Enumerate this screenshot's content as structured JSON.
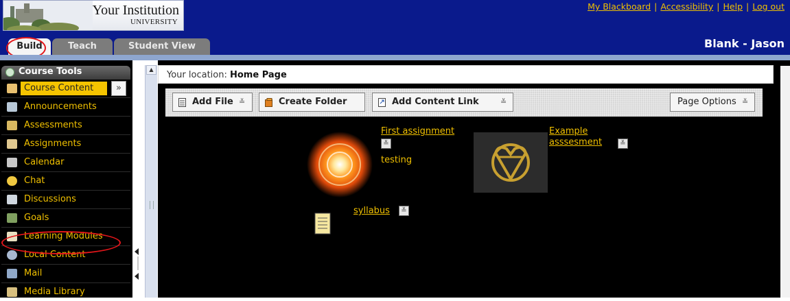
{
  "header": {
    "logo": {
      "name": "Your Institution",
      "subtitle": "UNIVERSITY"
    },
    "top_links": [
      "My Blackboard",
      "Accessibility",
      "Help",
      "Log out"
    ],
    "user_name": "Blank - Jason",
    "tabs": [
      {
        "label": "Build",
        "active": true
      },
      {
        "label": "Teach",
        "active": false
      },
      {
        "label": "Student View",
        "active": false
      }
    ]
  },
  "sidebar": {
    "title": "Course Tools",
    "items": [
      {
        "label": "Course Content",
        "icon": "home-icon",
        "selected": true
      },
      {
        "label": "Announcements",
        "icon": "megaphone-icon"
      },
      {
        "label": "Assessments",
        "icon": "assessment-icon"
      },
      {
        "label": "Assignments",
        "icon": "assignment-icon"
      },
      {
        "label": "Calendar",
        "icon": "calendar-icon"
      },
      {
        "label": "Chat",
        "icon": "chat-icon"
      },
      {
        "label": "Discussions",
        "icon": "discussion-icon"
      },
      {
        "label": "Goals",
        "icon": "goals-icon"
      },
      {
        "label": "Learning Modules",
        "icon": "module-icon"
      },
      {
        "label": "Local Content",
        "icon": "disc-icon"
      },
      {
        "label": "Mail",
        "icon": "mail-icon"
      },
      {
        "label": "Media Library",
        "icon": "media-icon"
      }
    ],
    "chevron": "»"
  },
  "main": {
    "location_label": "Your location:",
    "location_value": "Home Page",
    "actions": {
      "add_file": "Add File",
      "create_folder": "Create Folder",
      "add_content_link": "Add Content Link",
      "page_options": "Page Options",
      "dropdown_glyph": "≚"
    },
    "items": {
      "first_assignment": "First assignment",
      "testing": "testing",
      "example_assessment": "Example asssesment",
      "syllabus": "syllabus"
    }
  },
  "colors": {
    "header_bg": "#0a1a8c",
    "link_yellow": "#f0c000",
    "highlight_red": "#e3161a"
  }
}
